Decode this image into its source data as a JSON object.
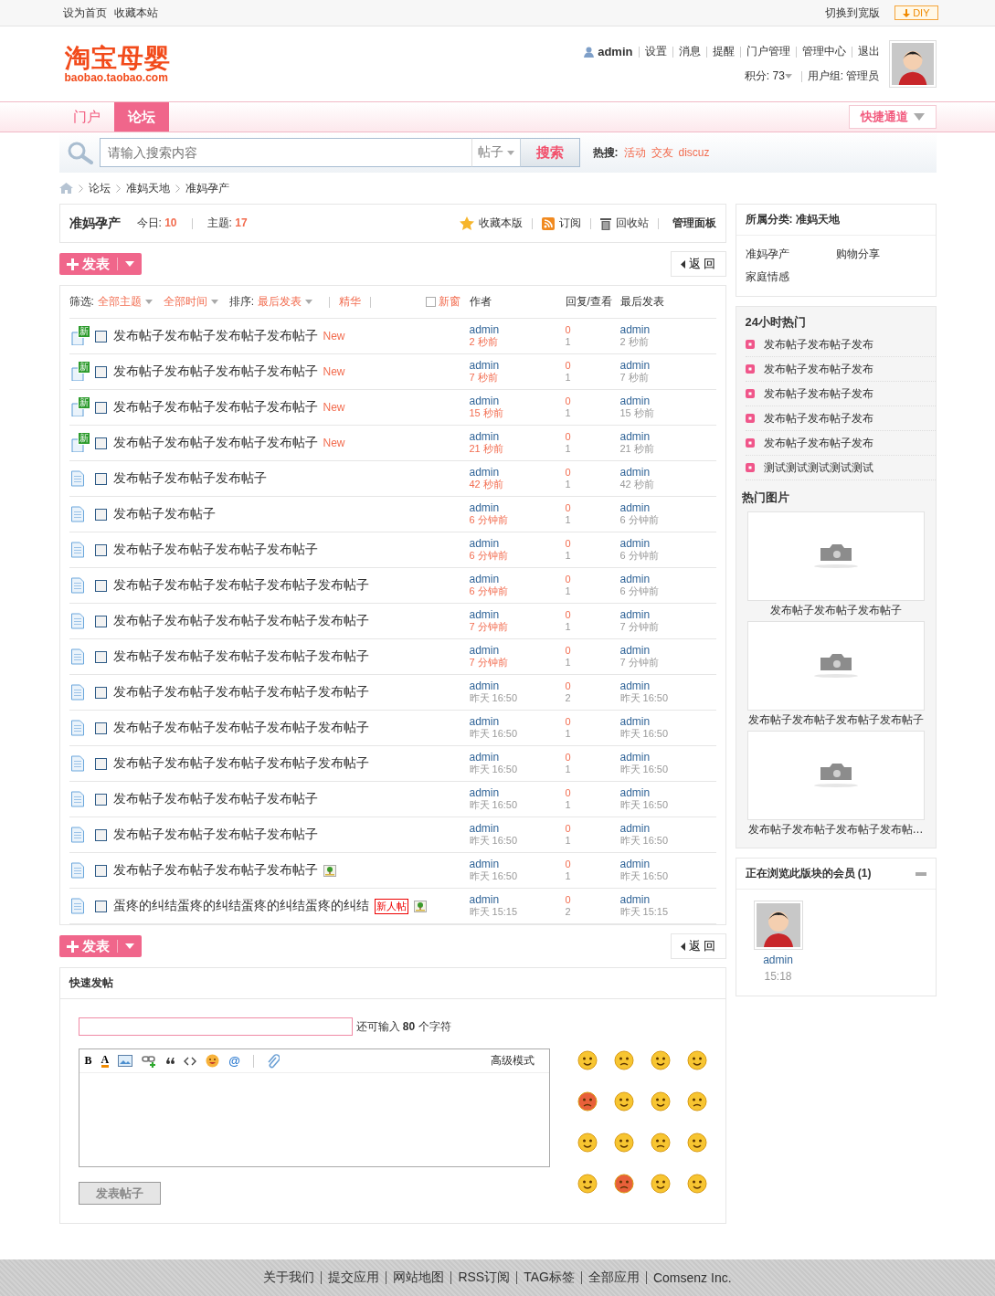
{
  "topbar": {
    "left_links": [
      "设为首页",
      "收藏本站"
    ],
    "switch_link": "切换到宽版",
    "diy_button": "DIY"
  },
  "logo": {
    "name": "淘宝母婴",
    "domain": "baobao.taobao.com"
  },
  "user": {
    "name": "admin",
    "links": [
      "设置",
      "消息",
      "提醒",
      "门户管理",
      "管理中心",
      "退出"
    ],
    "points": "积分: 73",
    "group": "用户组: 管理员"
  },
  "nav": {
    "tabs": [
      {
        "label": "门户",
        "selected": false
      },
      {
        "label": "论坛",
        "selected": true
      }
    ],
    "quick_menu": "快捷通道"
  },
  "search": {
    "placeholder": "请输入搜索内容",
    "type": "帖子",
    "button": "搜索",
    "hot_label": "热搜:",
    "hot_terms": [
      "活动",
      "交友",
      "discuz"
    ]
  },
  "breadcrumb": [
    "论坛",
    "准妈天地",
    "准妈孕产"
  ],
  "forum": {
    "title": "准妈孕产",
    "today_label": "今日:",
    "today": "10",
    "topics_label": "主题:",
    "topics": "17",
    "actions": [
      {
        "kind": "star",
        "label": "收藏本版"
      },
      {
        "kind": "rss",
        "label": "订阅"
      },
      {
        "kind": "trash",
        "label": "回收站"
      },
      {
        "kind": "panel",
        "label": "管理面板"
      }
    ]
  },
  "post_buttons": [
    "发表",
    "发表"
  ],
  "back_buttons": [
    "返 回",
    "返 回"
  ],
  "filters": {
    "label": "筛选:",
    "options": [
      "全部主题",
      "全部时间"
    ],
    "sort_label": "排序:",
    "sort": "最后发表",
    "digest": "精华",
    "new_window": {
      "label": "新窗",
      "checked": false
    },
    "columns": [
      "作者",
      "回复/查看",
      "最后发表"
    ]
  },
  "threads": [
    {
      "badge": "新",
      "title": "发布帖子发布帖子发布帖子发布帖子",
      "new_label": "New",
      "has_image": false,
      "author": "admin",
      "author_time": "2 秒前",
      "recent": true,
      "replies": "0",
      "views": "1",
      "last_author": "admin",
      "last_time": "2 秒前"
    },
    {
      "badge": "新",
      "title": "发布帖子发布帖子发布帖子发布帖子",
      "new_label": "New",
      "has_image": false,
      "author": "admin",
      "author_time": "7 秒前",
      "recent": true,
      "replies": "0",
      "views": "1",
      "last_author": "admin",
      "last_time": "7 秒前"
    },
    {
      "badge": "新",
      "title": "发布帖子发布帖子发布帖子发布帖子",
      "new_label": "New",
      "has_image": false,
      "author": "admin",
      "author_time": "15 秒前",
      "recent": true,
      "replies": "0",
      "views": "1",
      "last_author": "admin",
      "last_time": "15 秒前"
    },
    {
      "badge": "新",
      "title": "发布帖子发布帖子发布帖子发布帖子",
      "new_label": "New",
      "has_image": false,
      "author": "admin",
      "author_time": "21 秒前",
      "recent": true,
      "replies": "0",
      "views": "1",
      "last_author": "admin",
      "last_time": "21 秒前"
    },
    {
      "title": "发布帖子发布帖子发布帖子",
      "has_image": false,
      "author": "admin",
      "author_time": "42 秒前",
      "recent": true,
      "replies": "0",
      "views": "1",
      "last_author": "admin",
      "last_time": "42 秒前"
    },
    {
      "title": "发布帖子发布帖子",
      "has_image": false,
      "author": "admin",
      "author_time": "6 分钟前",
      "recent": true,
      "replies": "0",
      "views": "1",
      "last_author": "admin",
      "last_time": "6 分钟前"
    },
    {
      "title": "发布帖子发布帖子发布帖子发布帖子",
      "has_image": false,
      "author": "admin",
      "author_time": "6 分钟前",
      "recent": true,
      "replies": "0",
      "views": "1",
      "last_author": "admin",
      "last_time": "6 分钟前"
    },
    {
      "title": "发布帖子发布帖子发布帖子发布帖子发布帖子",
      "has_image": false,
      "author": "admin",
      "author_time": "6 分钟前",
      "recent": true,
      "replies": "0",
      "views": "1",
      "last_author": "admin",
      "last_time": "6 分钟前"
    },
    {
      "title": "发布帖子发布帖子发布帖子发布帖子发布帖子",
      "has_image": false,
      "author": "admin",
      "author_time": "7 分钟前",
      "recent": true,
      "replies": "0",
      "views": "1",
      "last_author": "admin",
      "last_time": "7 分钟前"
    },
    {
      "title": "发布帖子发布帖子发布帖子发布帖子发布帖子",
      "has_image": false,
      "author": "admin",
      "author_time": "7 分钟前",
      "recent": true,
      "replies": "0",
      "views": "1",
      "last_author": "admin",
      "last_time": "7 分钟前"
    },
    {
      "title": "发布帖子发布帖子发布帖子发布帖子发布帖子",
      "has_image": false,
      "author": "admin",
      "author_time": "昨天 16:50",
      "recent": false,
      "replies": "0",
      "views": "2",
      "last_author": "admin",
      "last_time": "昨天 16:50"
    },
    {
      "title": "发布帖子发布帖子发布帖子发布帖子发布帖子",
      "has_image": false,
      "author": "admin",
      "author_time": "昨天 16:50",
      "recent": false,
      "replies": "0",
      "views": "1",
      "last_author": "admin",
      "last_time": "昨天 16:50"
    },
    {
      "title": "发布帖子发布帖子发布帖子发布帖子发布帖子",
      "has_image": false,
      "author": "admin",
      "author_time": "昨天 16:50",
      "recent": false,
      "replies": "0",
      "views": "1",
      "last_author": "admin",
      "last_time": "昨天 16:50"
    },
    {
      "title": "发布帖子发布帖子发布帖子发布帖子",
      "has_image": false,
      "author": "admin",
      "author_time": "昨天 16:50",
      "recent": false,
      "replies": "0",
      "views": "1",
      "last_author": "admin",
      "last_time": "昨天 16:50"
    },
    {
      "title": "发布帖子发布帖子发布帖子发布帖子",
      "has_image": false,
      "author": "admin",
      "author_time": "昨天 16:50",
      "recent": false,
      "replies": "0",
      "views": "1",
      "last_author": "admin",
      "last_time": "昨天 16:50"
    },
    {
      "title": "发布帖子发布帖子发布帖子发布帖子",
      "has_image": true,
      "author": "admin",
      "author_time": "昨天 16:50",
      "recent": false,
      "replies": "0",
      "views": "1",
      "last_author": "admin",
      "last_time": "昨天 16:50"
    },
    {
      "title": "蛋疼的纠结蛋疼的纠结蛋疼的纠结蛋疼的纠结",
      "newbie_tag": "新人帖",
      "has_image": true,
      "author": "admin",
      "author_time": "昨天 15:15",
      "recent": false,
      "replies": "0",
      "views": "2",
      "last_author": "admin",
      "last_time": "昨天 15:15"
    }
  ],
  "quick_post": {
    "title": "快速发帖",
    "remaining": "还可输入 **80** 个字符",
    "toolbar": [
      {
        "kind": "bold",
        "label": "B"
      },
      {
        "kind": "color",
        "label": "A"
      },
      {
        "kind": "image"
      },
      {
        "kind": "link"
      },
      {
        "kind": "quote"
      },
      {
        "kind": "code"
      },
      {
        "kind": "smiley"
      },
      {
        "kind": "at",
        "label": "@"
      },
      {
        "kind": "attach"
      }
    ],
    "advanced": "高级模式",
    "submit": "发表帖子",
    "submit_disabled": true
  },
  "sidebar": {
    "category_label": "所属分类: 准妈天地",
    "subforums": [
      "准妈孕产",
      "购物分享",
      "家庭情感"
    ],
    "hot_title": "24小时热门",
    "hot_items": [
      "发布帖子发布帖子发布",
      "发布帖子发布帖子发布",
      "发布帖子发布帖子发布",
      "发布帖子发布帖子发布",
      "发布帖子发布帖子发布",
      "测试测试测试测试测试"
    ],
    "pictures_title": "热门图片",
    "pictures": [
      "发布帖子发布帖子发布帖子",
      "发布帖子发布帖子发布帖子发布帖子",
      "发布帖子发布帖子发布帖子发布帖…"
    ],
    "online_title": "正在浏览此版块的会员",
    "online_count": "(1)",
    "members": [
      {
        "name": "admin",
        "time": "15:18"
      }
    ]
  },
  "footer": [
    "关于我们",
    "提交应用",
    "网站地图",
    "RSS订阅",
    "TAG标签",
    "全部应用",
    "Comsenz Inc."
  ]
}
